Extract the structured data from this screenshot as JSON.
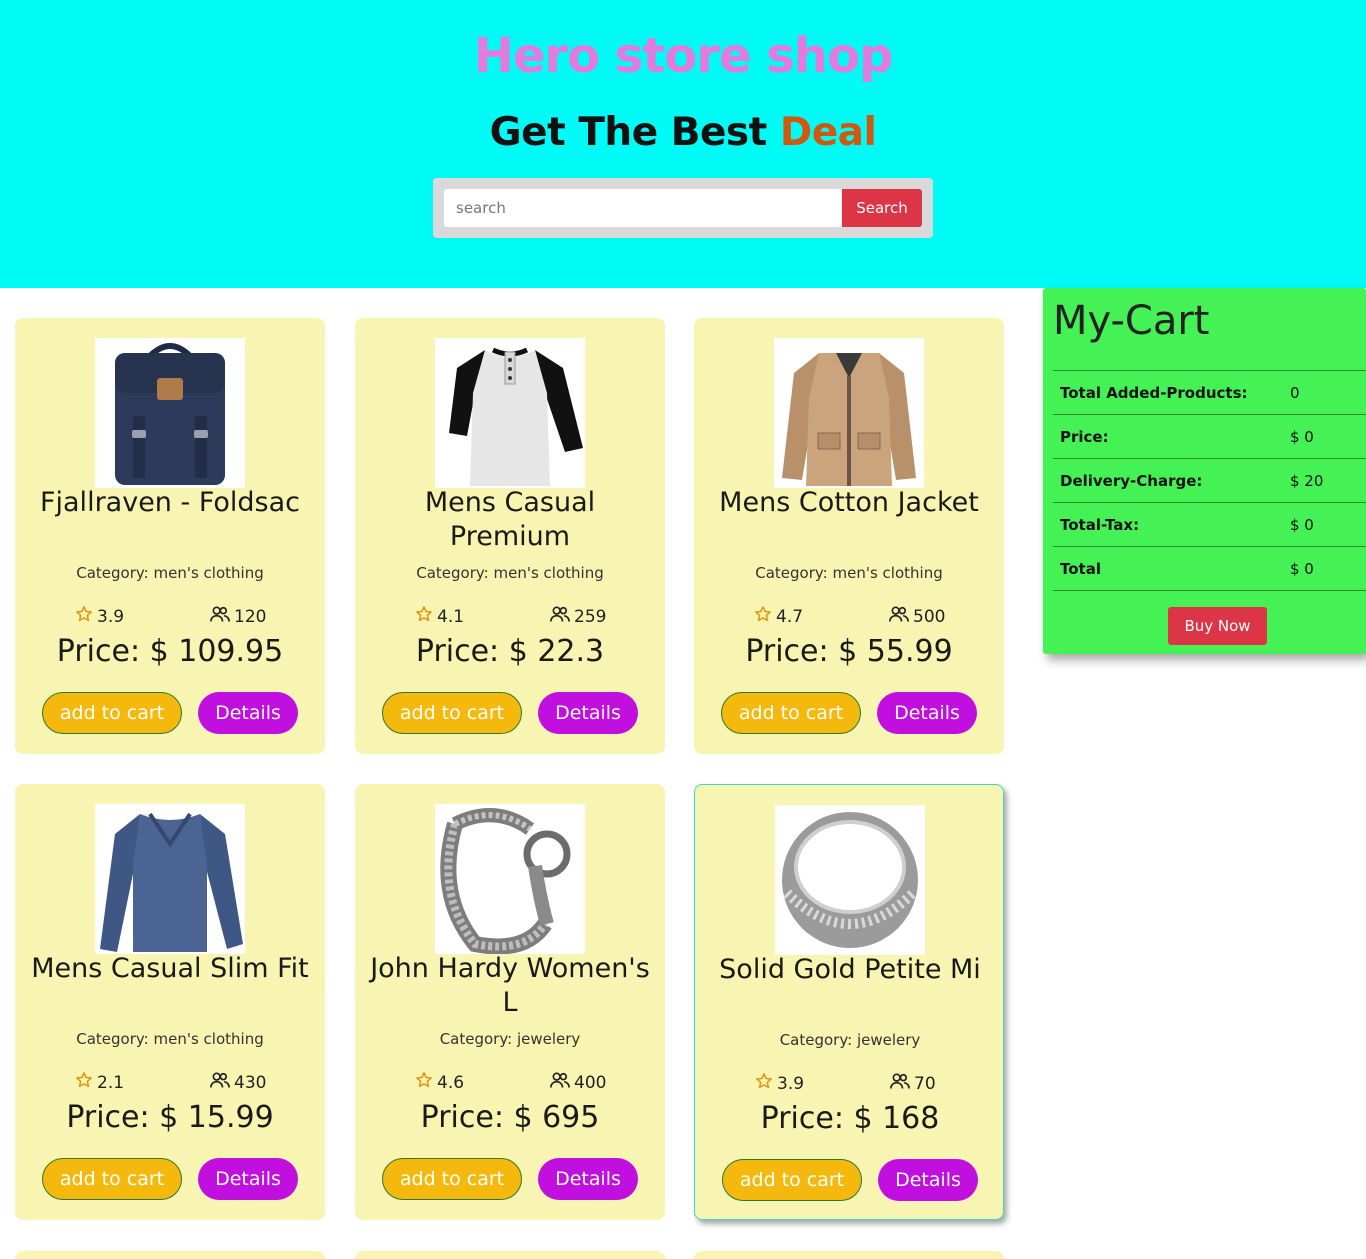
{
  "header": {
    "title": "Hero store shop",
    "subtitle_main": "Get The Best ",
    "subtitle_accent": "Deal",
    "search_placeholder": "search",
    "search_button": "Search"
  },
  "colors": {
    "hero_bg": "#00fbf6",
    "title": "#e37bdc",
    "accent": "#d0580f",
    "card_bg": "#f7f5b1",
    "add_button": "#f5b80d",
    "details_button": "#c10fe0",
    "cart_bg": "#45f256",
    "buy_button": "#dc3545"
  },
  "products": [
    {
      "title": "Fjallraven - Foldsac",
      "category": "Category: men's clothing",
      "rating": "3.9",
      "count": "120",
      "price": "Price: $ 109.95",
      "add_label": "add to cart",
      "details_label": "Details",
      "image": "backpack"
    },
    {
      "title": "Mens Casual Premium",
      "category": "Category: men's clothing",
      "rating": "4.1",
      "count": "259",
      "price": "Price: $ 22.3",
      "add_label": "add to cart",
      "details_label": "Details",
      "image": "raglan-shirt"
    },
    {
      "title": "Mens Cotton Jacket",
      "category": "Category: men's clothing",
      "rating": "4.7",
      "count": "500",
      "price": "Price: $ 55.99",
      "add_label": "add to cart",
      "details_label": "Details",
      "image": "jacket"
    },
    {
      "title": "Mens Casual Slim Fit",
      "category": "Category: men's clothing",
      "rating": "2.1",
      "count": "430",
      "price": "Price: $ 15.99",
      "add_label": "add to cart",
      "details_label": "Details",
      "image": "longsleeve-shirt"
    },
    {
      "title": "John Hardy Women's L",
      "category": "Category: jewelery",
      "rating": "4.6",
      "count": "400",
      "price": "Price: $ 695",
      "add_label": "add to cart",
      "details_label": "Details",
      "image": "bracelet"
    },
    {
      "title": "Solid Gold Petite Mi",
      "category": "Category: jewelery",
      "rating": "3.9",
      "count": "70",
      "price": "Price: $ 168",
      "add_label": "add to cart",
      "details_label": "Details",
      "image": "ring"
    }
  ],
  "cart": {
    "title": "My-Cart",
    "rows": [
      {
        "label": "Total Added-Products:",
        "value": "0"
      },
      {
        "label": "Price:",
        "value": "$ 0"
      },
      {
        "label": "Delivery-Charge:",
        "value": "$ 20"
      },
      {
        "label": "Total-Tax:",
        "value": "$ 0"
      },
      {
        "label": "Total",
        "value": "$ 0"
      }
    ],
    "buy_label": "Buy Now"
  }
}
